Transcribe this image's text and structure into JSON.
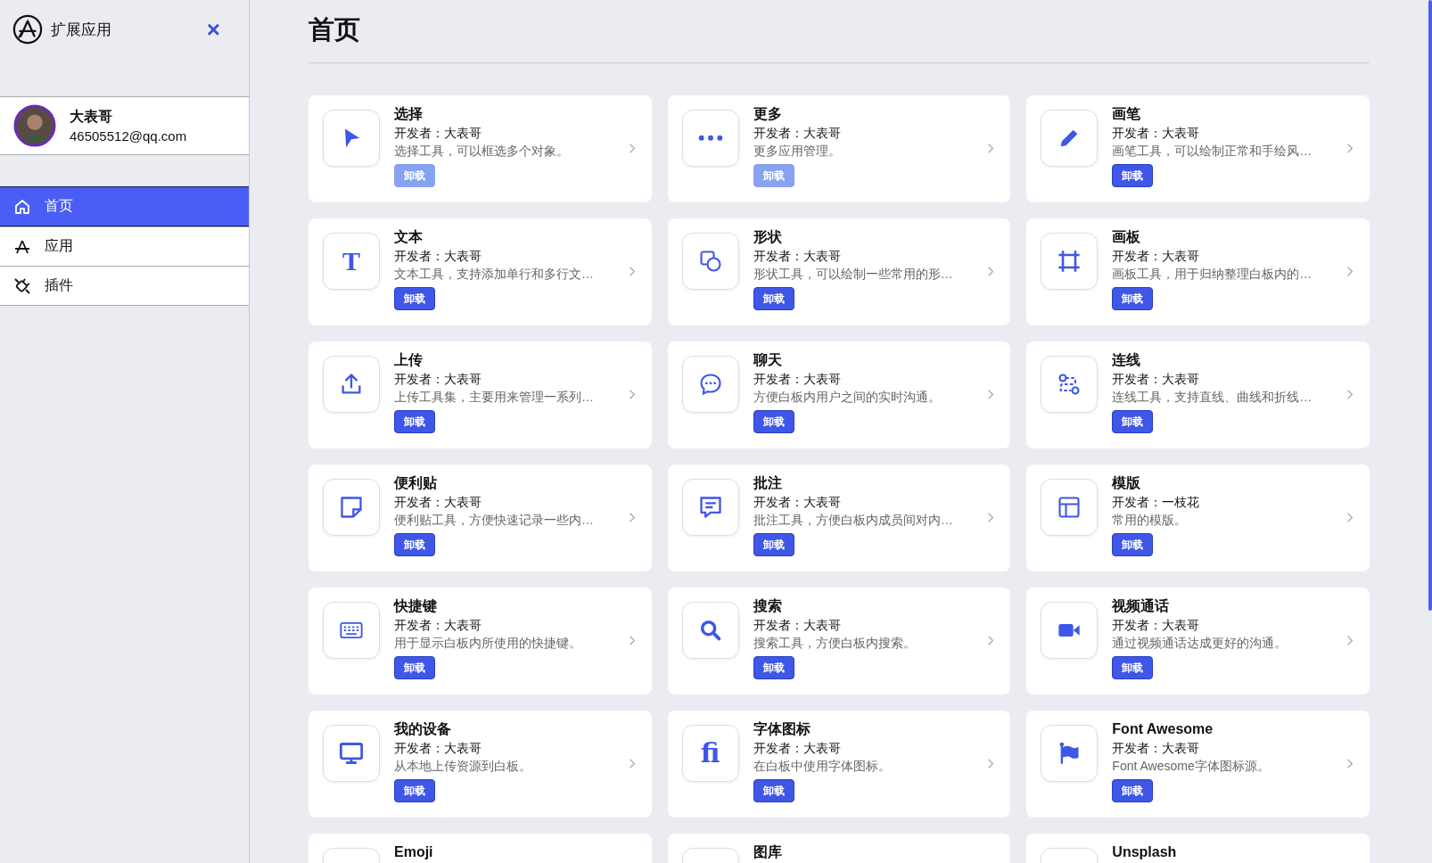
{
  "sidebar": {
    "title": "扩展应用",
    "close": "×",
    "user": {
      "name": "大表哥",
      "email": "46505512@qq.com"
    },
    "items": [
      {
        "label": "首页",
        "selected": true
      },
      {
        "label": "应用",
        "selected": false
      },
      {
        "label": "插件",
        "selected": false
      }
    ]
  },
  "page": {
    "title": "首页"
  },
  "cards": [
    {
      "title": "选择",
      "developer": "开发者：大表哥",
      "description": "选择工具，可以框选多个对象。",
      "button": "卸载",
      "disabled": true
    },
    {
      "title": "更多",
      "developer": "开发者：大表哥",
      "description": "更多应用管理。",
      "button": "卸载",
      "disabled": true
    },
    {
      "title": "画笔",
      "developer": "开发者：大表哥",
      "description": "画笔工具，可以绘制正常和手绘风…",
      "button": "卸载",
      "disabled": false
    },
    {
      "title": "文本",
      "glyph": "T",
      "developer": "开发者：大表哥",
      "description": "文本工具，支持添加单行和多行文…",
      "button": "卸载",
      "disabled": false
    },
    {
      "title": "形状",
      "developer": "开发者：大表哥",
      "description": "形状工具，可以绘制一些常用的形…",
      "button": "卸载",
      "disabled": false
    },
    {
      "title": "画板",
      "developer": "开发者：大表哥",
      "description": "画板工具，用于归纳整理白板内的…",
      "button": "卸载",
      "disabled": false
    },
    {
      "title": "上传",
      "developer": "开发者：大表哥",
      "description": "上传工具集，主要用来管理一系列…",
      "button": "卸载",
      "disabled": false
    },
    {
      "title": "聊天",
      "developer": "开发者：大表哥",
      "description": "方便白板内用户之间的实时沟通。",
      "button": "卸载",
      "disabled": false
    },
    {
      "title": "连线",
      "developer": "开发者：大表哥",
      "description": "连线工具，支持直线、曲线和折线…",
      "button": "卸载",
      "disabled": false
    },
    {
      "title": "便利贴",
      "developer": "开发者：大表哥",
      "description": "便利贴工具，方便快速记录一些内…",
      "button": "卸载",
      "disabled": false
    },
    {
      "title": "批注",
      "developer": "开发者：大表哥",
      "description": "批注工具，方便白板内成员间对内…",
      "button": "卸载",
      "disabled": false
    },
    {
      "title": "模版",
      "developer": "开发者：一枝花",
      "description": "常用的模版。",
      "button": "卸载",
      "disabled": false
    },
    {
      "title": "快捷键",
      "developer": "开发者：大表哥",
      "description": "用于显示白板内所使用的快捷键。",
      "button": "卸载",
      "disabled": false
    },
    {
      "title": "搜索",
      "developer": "开发者：大表哥",
      "description": "搜索工具，方便白板内搜索。",
      "button": "卸载",
      "disabled": false
    },
    {
      "title": "视频通话",
      "developer": "开发者：大表哥",
      "description": "通过视频通话达成更好的沟通。",
      "button": "卸载",
      "disabled": false
    },
    {
      "title": "我的设备",
      "developer": "开发者：大表哥",
      "description": "从本地上传资源到白板。",
      "button": "卸载",
      "disabled": false
    },
    {
      "title": "字体图标",
      "glyph": "fi",
      "developer": "开发者：大表哥",
      "description": "在白板中使用字体图标。",
      "button": "卸载",
      "disabled": false
    },
    {
      "title": "Font Awesome",
      "developer": "开发者：大表哥",
      "description": "Font Awesome字体图标源。",
      "button": "卸载",
      "disabled": false
    },
    {
      "title": "Emoji"
    },
    {
      "title": "图库"
    },
    {
      "title": "Unsplash"
    }
  ]
}
